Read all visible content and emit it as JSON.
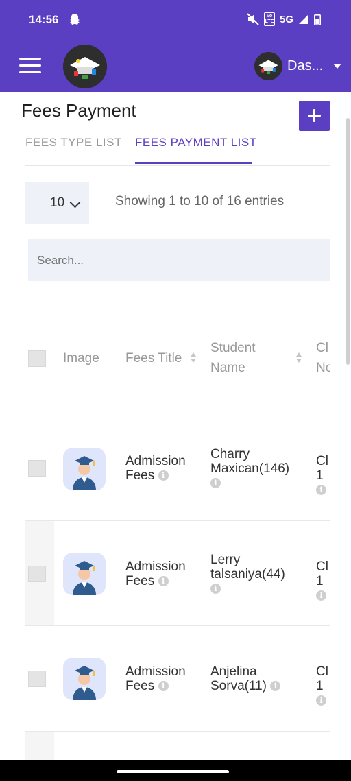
{
  "status_bar": {
    "time": "14:56",
    "network": "5G",
    "volte": "Vo LTE",
    "icons": [
      "snapchat-icon",
      "mute-icon",
      "volte-icon",
      "signal-icon",
      "battery-icon"
    ]
  },
  "app_bar": {
    "menu_icon": "hamburger-icon",
    "profile_name": "Das...",
    "colors": {
      "primary": "#5b3fc2"
    }
  },
  "page": {
    "title": "Fees Payment",
    "add_icon": "plus-icon"
  },
  "tabs": [
    {
      "label": "FEES TYPE LIST",
      "active": false
    },
    {
      "label": "FEES PAYMENT LIST",
      "active": true
    }
  ],
  "list_controls": {
    "page_size": "10",
    "entries_info": "Showing 1 to 10 of 16 entries",
    "search_placeholder": "Search..."
  },
  "table": {
    "headers": {
      "image": "Image",
      "fees_title": "Fees Title",
      "student_name_1": "Student",
      "student_name_2": "Name",
      "class_1": "Cl",
      "class_2": "Nc"
    },
    "rows": [
      {
        "fees_1": "Admission",
        "fees_2": "Fees",
        "student_1": "Charry",
        "student_2": "Maxican(146)",
        "class_1": "Cl",
        "class_2": "1"
      },
      {
        "fees_1": "Admission",
        "fees_2": "Fees",
        "student_1": "Lerry",
        "student_2": "talsaniya(44)",
        "class_1": "Cl",
        "class_2": "1"
      },
      {
        "fees_1": "Admission",
        "fees_2": "Fees",
        "student_1": "Anjelina",
        "student_2": "Sorva(11)",
        "class_1": "Cl",
        "class_2": "1"
      }
    ]
  }
}
